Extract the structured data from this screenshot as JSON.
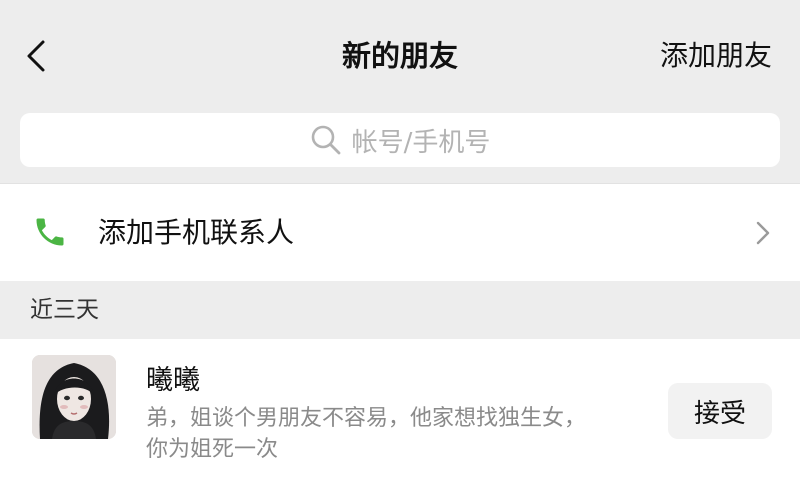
{
  "nav": {
    "title": "新的朋友",
    "action_label": "添加朋友",
    "back_icon": "chevron-left-icon"
  },
  "search": {
    "placeholder": "帐号/手机号",
    "icon": "search-icon"
  },
  "add_phone_contact": {
    "label": "添加手机联系人",
    "icon": "phone-icon",
    "icon_color": "#4bb544",
    "chevron_icon": "chevron-right-icon"
  },
  "section": {
    "title": "近三天"
  },
  "requests": [
    {
      "name": "曦曦",
      "message_line1": "弟，姐谈个男朋友不容易，他家想找独生女，",
      "message_line2": "你为姐死一次",
      "accept_label": "接受"
    }
  ],
  "colors": {
    "background": "#ededed",
    "card": "#ffffff",
    "secondary_text": "#8a8a8a",
    "placeholder": "#b3b3b3"
  }
}
